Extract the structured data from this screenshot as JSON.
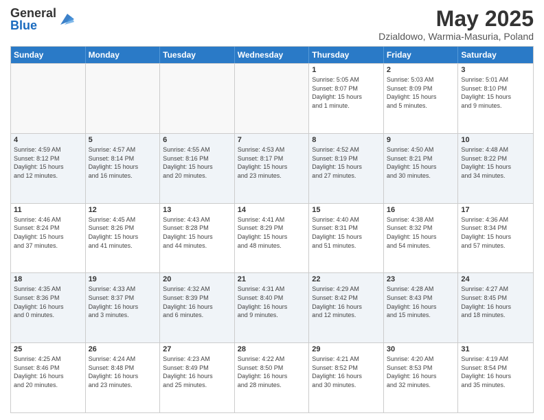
{
  "logo": {
    "general": "General",
    "blue": "Blue"
  },
  "title": {
    "month": "May 2025",
    "location": "Dzialdowo, Warmia-Masuria, Poland"
  },
  "days_of_week": [
    "Sunday",
    "Monday",
    "Tuesday",
    "Wednesday",
    "Thursday",
    "Friday",
    "Saturday"
  ],
  "weeks": [
    {
      "cells": [
        {
          "day": "",
          "info": "",
          "empty": true
        },
        {
          "day": "",
          "info": "",
          "empty": true
        },
        {
          "day": "",
          "info": "",
          "empty": true
        },
        {
          "day": "",
          "info": "",
          "empty": true
        },
        {
          "day": "1",
          "info": "Sunrise: 5:05 AM\nSunset: 8:07 PM\nDaylight: 15 hours\nand 1 minute."
        },
        {
          "day": "2",
          "info": "Sunrise: 5:03 AM\nSunset: 8:09 PM\nDaylight: 15 hours\nand 5 minutes."
        },
        {
          "day": "3",
          "info": "Sunrise: 5:01 AM\nSunset: 8:10 PM\nDaylight: 15 hours\nand 9 minutes."
        }
      ]
    },
    {
      "cells": [
        {
          "day": "4",
          "info": "Sunrise: 4:59 AM\nSunset: 8:12 PM\nDaylight: 15 hours\nand 12 minutes."
        },
        {
          "day": "5",
          "info": "Sunrise: 4:57 AM\nSunset: 8:14 PM\nDaylight: 15 hours\nand 16 minutes."
        },
        {
          "day": "6",
          "info": "Sunrise: 4:55 AM\nSunset: 8:16 PM\nDaylight: 15 hours\nand 20 minutes."
        },
        {
          "day": "7",
          "info": "Sunrise: 4:53 AM\nSunset: 8:17 PM\nDaylight: 15 hours\nand 23 minutes."
        },
        {
          "day": "8",
          "info": "Sunrise: 4:52 AM\nSunset: 8:19 PM\nDaylight: 15 hours\nand 27 minutes."
        },
        {
          "day": "9",
          "info": "Sunrise: 4:50 AM\nSunset: 8:21 PM\nDaylight: 15 hours\nand 30 minutes."
        },
        {
          "day": "10",
          "info": "Sunrise: 4:48 AM\nSunset: 8:22 PM\nDaylight: 15 hours\nand 34 minutes."
        }
      ]
    },
    {
      "cells": [
        {
          "day": "11",
          "info": "Sunrise: 4:46 AM\nSunset: 8:24 PM\nDaylight: 15 hours\nand 37 minutes."
        },
        {
          "day": "12",
          "info": "Sunrise: 4:45 AM\nSunset: 8:26 PM\nDaylight: 15 hours\nand 41 minutes."
        },
        {
          "day": "13",
          "info": "Sunrise: 4:43 AM\nSunset: 8:28 PM\nDaylight: 15 hours\nand 44 minutes."
        },
        {
          "day": "14",
          "info": "Sunrise: 4:41 AM\nSunset: 8:29 PM\nDaylight: 15 hours\nand 48 minutes."
        },
        {
          "day": "15",
          "info": "Sunrise: 4:40 AM\nSunset: 8:31 PM\nDaylight: 15 hours\nand 51 minutes."
        },
        {
          "day": "16",
          "info": "Sunrise: 4:38 AM\nSunset: 8:32 PM\nDaylight: 15 hours\nand 54 minutes."
        },
        {
          "day": "17",
          "info": "Sunrise: 4:36 AM\nSunset: 8:34 PM\nDaylight: 15 hours\nand 57 minutes."
        }
      ]
    },
    {
      "cells": [
        {
          "day": "18",
          "info": "Sunrise: 4:35 AM\nSunset: 8:36 PM\nDaylight: 16 hours\nand 0 minutes."
        },
        {
          "day": "19",
          "info": "Sunrise: 4:33 AM\nSunset: 8:37 PM\nDaylight: 16 hours\nand 3 minutes."
        },
        {
          "day": "20",
          "info": "Sunrise: 4:32 AM\nSunset: 8:39 PM\nDaylight: 16 hours\nand 6 minutes."
        },
        {
          "day": "21",
          "info": "Sunrise: 4:31 AM\nSunset: 8:40 PM\nDaylight: 16 hours\nand 9 minutes."
        },
        {
          "day": "22",
          "info": "Sunrise: 4:29 AM\nSunset: 8:42 PM\nDaylight: 16 hours\nand 12 minutes."
        },
        {
          "day": "23",
          "info": "Sunrise: 4:28 AM\nSunset: 8:43 PM\nDaylight: 16 hours\nand 15 minutes."
        },
        {
          "day": "24",
          "info": "Sunrise: 4:27 AM\nSunset: 8:45 PM\nDaylight: 16 hours\nand 18 minutes."
        }
      ]
    },
    {
      "cells": [
        {
          "day": "25",
          "info": "Sunrise: 4:25 AM\nSunset: 8:46 PM\nDaylight: 16 hours\nand 20 minutes."
        },
        {
          "day": "26",
          "info": "Sunrise: 4:24 AM\nSunset: 8:48 PM\nDaylight: 16 hours\nand 23 minutes."
        },
        {
          "day": "27",
          "info": "Sunrise: 4:23 AM\nSunset: 8:49 PM\nDaylight: 16 hours\nand 25 minutes."
        },
        {
          "day": "28",
          "info": "Sunrise: 4:22 AM\nSunset: 8:50 PM\nDaylight: 16 hours\nand 28 minutes."
        },
        {
          "day": "29",
          "info": "Sunrise: 4:21 AM\nSunset: 8:52 PM\nDaylight: 16 hours\nand 30 minutes."
        },
        {
          "day": "30",
          "info": "Sunrise: 4:20 AM\nSunset: 8:53 PM\nDaylight: 16 hours\nand 32 minutes."
        },
        {
          "day": "31",
          "info": "Sunrise: 4:19 AM\nSunset: 8:54 PM\nDaylight: 16 hours\nand 35 minutes."
        }
      ]
    }
  ]
}
